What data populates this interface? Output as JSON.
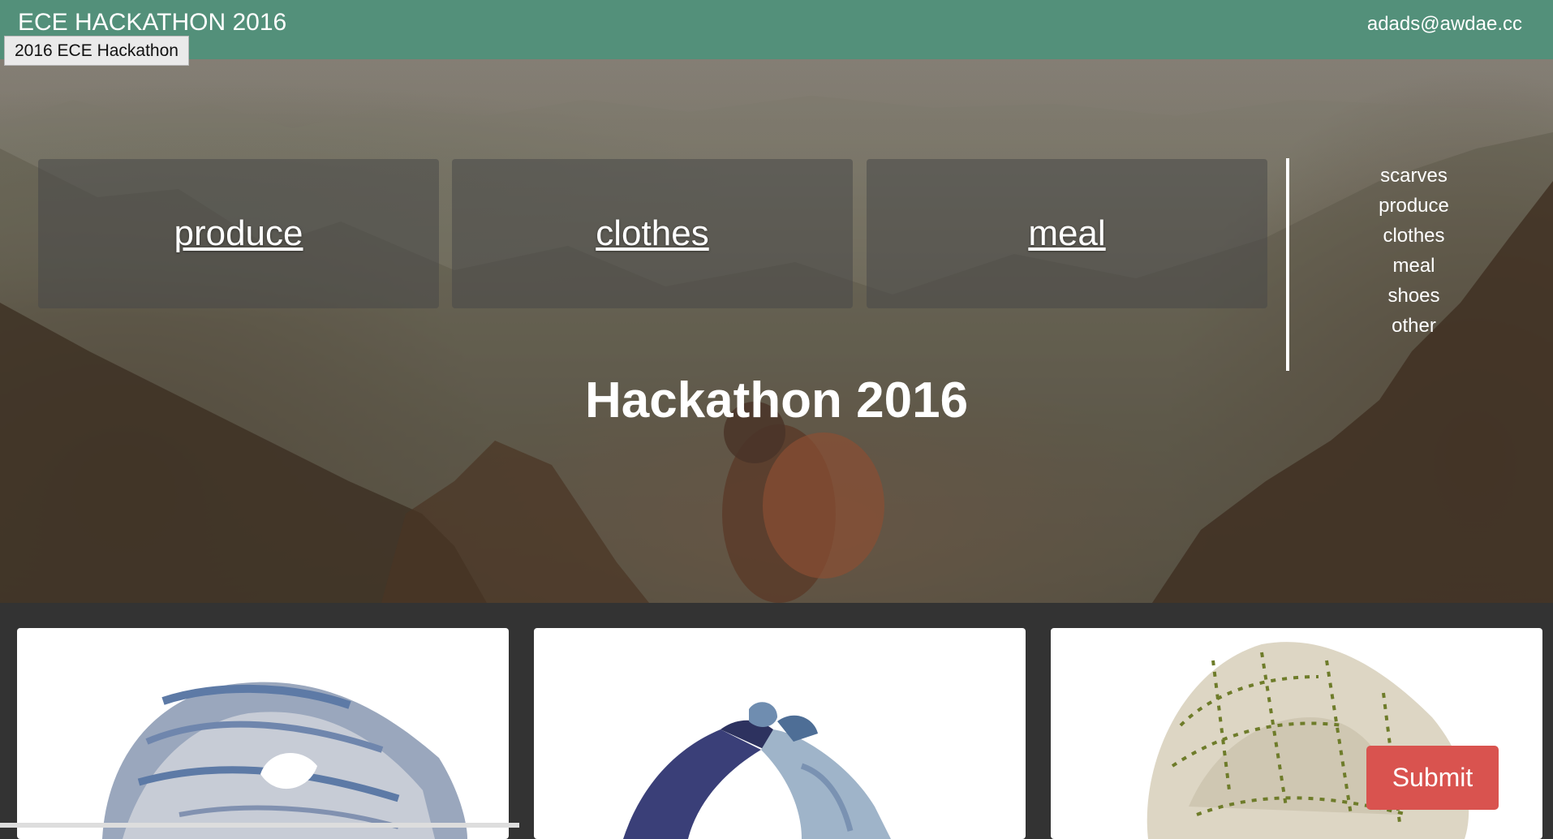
{
  "header": {
    "brand": "ECE HACKATHON 2016",
    "tooltip": "2016 ECE Hackathon",
    "user_email": "adads@awdae.cc"
  },
  "hero": {
    "title": "Hackathon 2016",
    "categories": [
      {
        "label": "produce"
      },
      {
        "label": "clothes"
      },
      {
        "label": "meal"
      }
    ],
    "side_list": [
      "scarves",
      "produce",
      "clothes",
      "meal",
      "shoes",
      "other"
    ]
  },
  "actions": {
    "submit_label": "Submit",
    "submit_color": "#d9534f"
  },
  "colors": {
    "navbar": "#53907a",
    "page_background": "#333333"
  }
}
